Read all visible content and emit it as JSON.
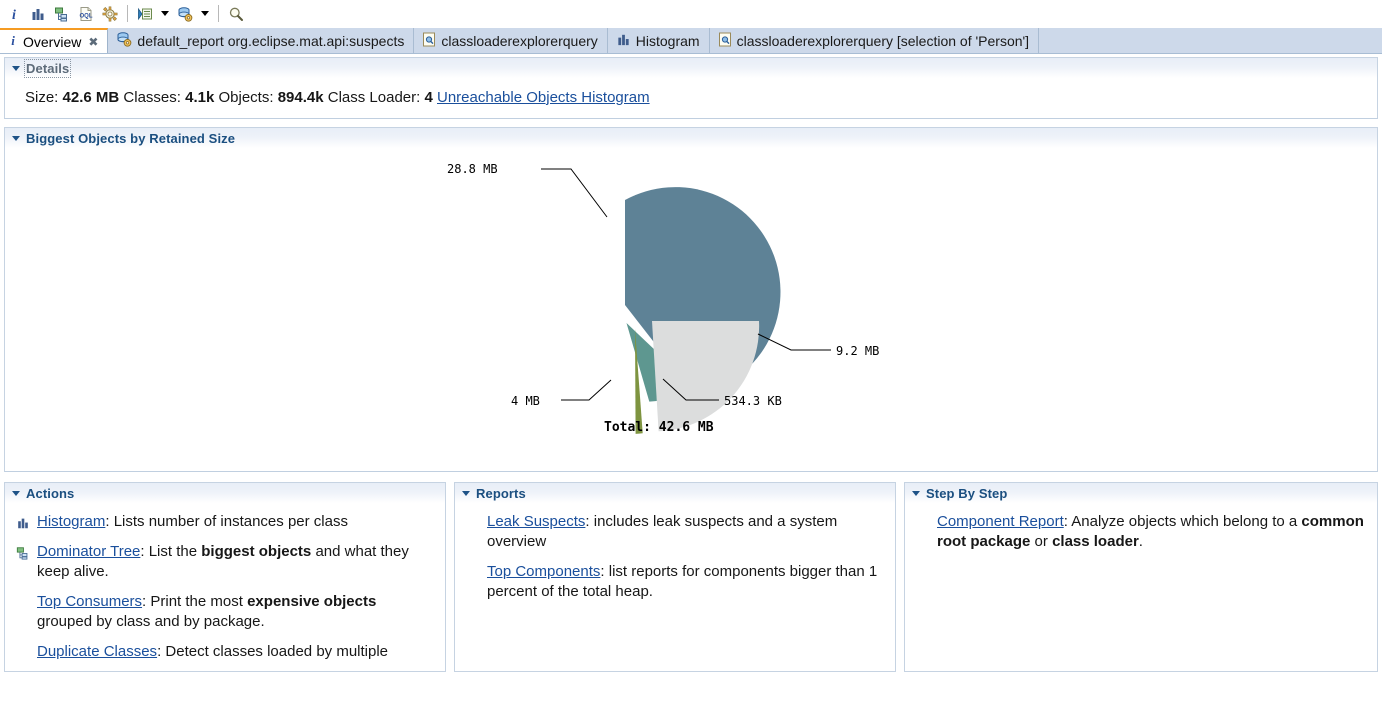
{
  "toolbar": {
    "buttons": [
      {
        "name": "overview-info-icon",
        "label": "i"
      },
      {
        "name": "histogram-icon",
        "label": "Histogram"
      },
      {
        "name": "dominator-tree-icon",
        "label": "Dominator Tree"
      },
      {
        "name": "oql-icon",
        "label": "OQL"
      },
      {
        "name": "calculate-retained-size-icon",
        "label": "Calculate Retained Size"
      },
      {
        "name": "run-expert-system-test-icon",
        "label": "Run Expert System Test"
      },
      {
        "name": "query-browser-icon",
        "label": "Query Browser"
      },
      {
        "name": "search-icon",
        "label": "Find"
      }
    ]
  },
  "tabs": [
    {
      "label": "Overview",
      "icon": "info-icon",
      "active": true,
      "closable": true
    },
    {
      "label": "default_report  org.eclipse.mat.api:suspects",
      "icon": "report-icon",
      "active": false,
      "closable": false
    },
    {
      "label": "classloaderexplorerquery",
      "icon": "query-icon",
      "active": false,
      "closable": false
    },
    {
      "label": "Histogram",
      "icon": "histogram-icon",
      "active": false,
      "closable": false
    },
    {
      "label": "classloaderexplorerquery [selection of 'Person']",
      "icon": "query-icon",
      "active": false,
      "closable": false
    }
  ],
  "details": {
    "section_title": "Details",
    "size_label": "Size:",
    "size_value": "42.6 MB",
    "classes_label": "Classes:",
    "classes_value": "4.1k",
    "objects_label": "Objects:",
    "objects_value": "894.4k",
    "classloader_label": "Class Loader:",
    "classloader_value": "4",
    "unreachable_link": "Unreachable Objects Histogram"
  },
  "biggest_objects": {
    "section_title": "Biggest Objects by Retained Size"
  },
  "chart_data": {
    "type": "pie",
    "title": "Biggest Objects by Retained Size",
    "total_label": "Total: 42.6 MB",
    "total_value_bytes": 44670976,
    "unit": "MB",
    "labels": [
      "28.8 MB",
      "9.2 MB",
      "534.3 KB",
      "4 MB"
    ],
    "values": [
      28.8,
      9.2,
      0.522,
      4.0
    ],
    "colors": [
      "#5e8296",
      "#dcdddd",
      "#7e9440",
      "#5e9790"
    ],
    "exploded": true,
    "legend": "none",
    "grid": false,
    "slices": [
      {
        "label": "28.8 MB",
        "value": 28.8,
        "percent": 67.6,
        "color": "#5e8296"
      },
      {
        "label": "9.2 MB",
        "value": 9.2,
        "percent": 21.6,
        "color": "#dcdddd"
      },
      {
        "label": "534.3 KB",
        "value": 0.522,
        "percent": 1.2,
        "color": "#7e9440"
      },
      {
        "label": "4 MB",
        "value": 4.0,
        "percent": 9.4,
        "color": "#5e9790"
      }
    ]
  },
  "actions": {
    "section_title": "Actions",
    "items": [
      {
        "icon": "histogram-icon",
        "link": "Histogram",
        "text": ": Lists number of instances per class",
        "bold_parts": []
      },
      {
        "icon": "dominator-tree-icon",
        "link": "Dominator Tree",
        "text": ": List the ",
        "bold": "biggest objects",
        "text2": " and what they keep alive."
      },
      {
        "icon": "none",
        "link": "Top Consumers",
        "text": ": Print the most ",
        "bold": "expensive objects",
        "text2": " grouped by class and by package."
      },
      {
        "icon": "none",
        "link": "Duplicate Classes",
        "text": ": Detect classes loaded by multiple",
        "bold": "",
        "text2": ""
      }
    ]
  },
  "reports": {
    "section_title": "Reports",
    "items": [
      {
        "link": "Leak Suspects",
        "text": ": includes leak suspects and a system overview"
      },
      {
        "link": "Top Components",
        "text": ": list reports for components bigger than 1 percent of the total heap."
      }
    ]
  },
  "step_by_step": {
    "section_title": "Step By Step",
    "items": [
      {
        "link": "Component Report",
        "text": ": Analyze objects which belong to a ",
        "bold": "common root package",
        "text2": " or ",
        "bold2": "class loader",
        "text3": "."
      }
    ]
  },
  "colors": {
    "link": "#1a4f9c",
    "section_title": "#1b4f80",
    "tab_active_accent": "#f59b23",
    "tab_bar_bg": "#cdd9ea"
  }
}
